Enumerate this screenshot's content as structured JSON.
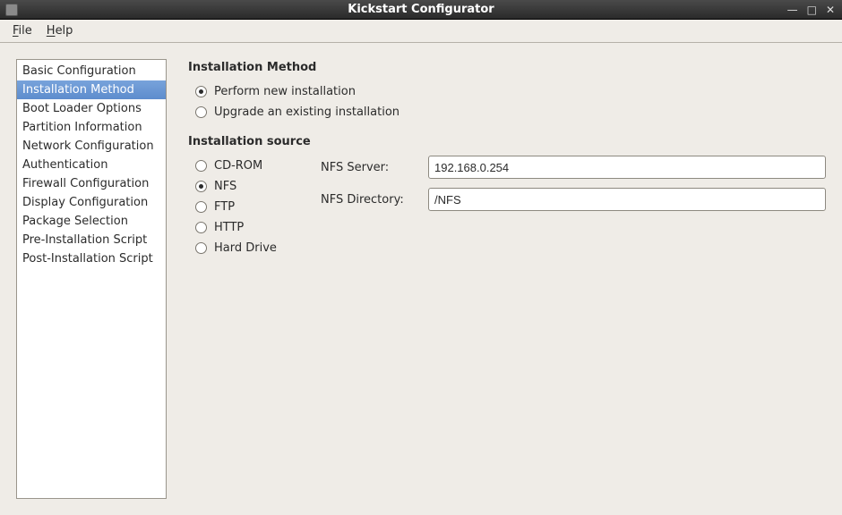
{
  "window": {
    "title": "Kickstart Configurator"
  },
  "menubar": {
    "file": "File",
    "help": "Help"
  },
  "sidebar": {
    "items": [
      {
        "label": "Basic Configuration"
      },
      {
        "label": "Installation Method"
      },
      {
        "label": "Boot Loader Options"
      },
      {
        "label": "Partition Information"
      },
      {
        "label": "Network Configuration"
      },
      {
        "label": "Authentication"
      },
      {
        "label": "Firewall Configuration"
      },
      {
        "label": "Display Configuration"
      },
      {
        "label": "Package Selection"
      },
      {
        "label": "Pre-Installation Script"
      },
      {
        "label": "Post-Installation Script"
      }
    ],
    "selected_index": 1
  },
  "main": {
    "sections": {
      "method": {
        "title": "Installation Method",
        "options": {
          "new": "Perform new installation",
          "upgrade": "Upgrade an existing installation"
        },
        "selected": "new"
      },
      "source": {
        "title": "Installation source",
        "options": {
          "cdrom": "CD-ROM",
          "nfs": "NFS",
          "ftp": "FTP",
          "http": "HTTP",
          "hdd": "Hard Drive"
        },
        "selected": "nfs",
        "fields": {
          "nfs_server": {
            "label": "NFS Server:",
            "value": "192.168.0.254"
          },
          "nfs_directory": {
            "label": "NFS Directory:",
            "value": "/NFS"
          }
        }
      }
    }
  }
}
